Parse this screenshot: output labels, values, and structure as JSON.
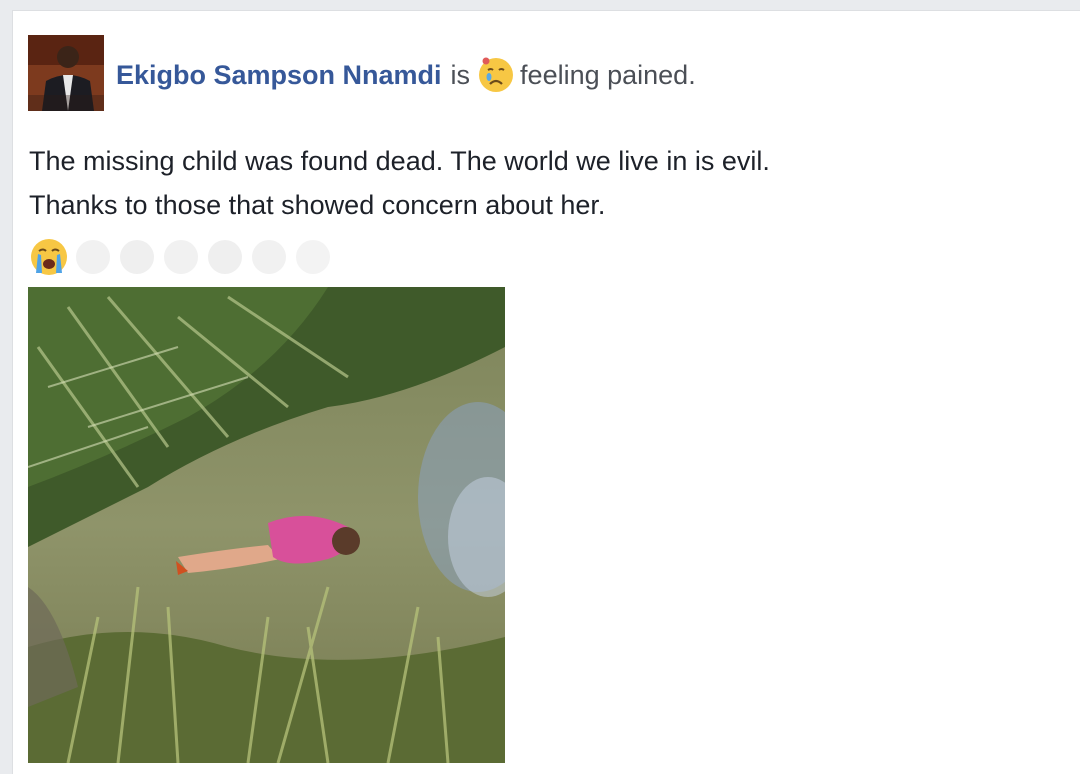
{
  "post": {
    "author_name": "Ekigbo Sampson Nnamdi",
    "is_word": "is",
    "feeling_text": "feeling pained.",
    "feeling_icon": "crying-face-icon",
    "text_lines": [
      "The missing child was found dead. The world we live in is evil.",
      "Thanks to those that showed concern about her."
    ],
    "reaction_emojis": [
      "loudly-crying-face-icon",
      "faded-emoji-icon",
      "faded-emoji-icon",
      "faded-emoji-icon",
      "faded-emoji-icon",
      "faded-emoji-icon",
      "faded-emoji-icon"
    ]
  },
  "colors": {
    "author_link": "#365899",
    "body_text": "#1d2129",
    "muted_text": "#4b4f56",
    "emoji_yellow": "#f7c744"
  }
}
